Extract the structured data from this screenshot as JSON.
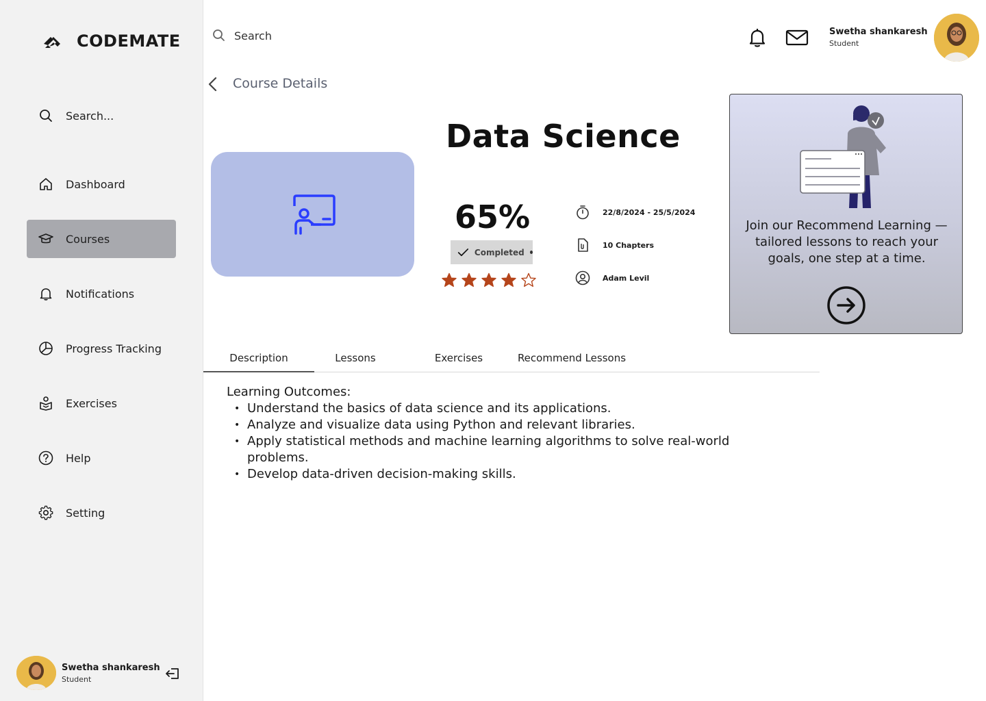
{
  "app": {
    "brand": "CODEMATE"
  },
  "sidebar": {
    "search_label": "Search...",
    "items": [
      {
        "label": "Dashboard",
        "icon": "home-icon"
      },
      {
        "label": "Courses",
        "icon": "graduation-cap-icon",
        "active": true
      },
      {
        "label": "Notifications",
        "icon": "bell-icon"
      },
      {
        "label": "Progress Tracking",
        "icon": "pie-chart-icon"
      },
      {
        "label": "Exercises",
        "icon": "exercise-icon"
      },
      {
        "label": "Help",
        "icon": "help-icon"
      },
      {
        "label": "Setting",
        "icon": "gear-icon"
      }
    ],
    "profile": {
      "name": "Swetha shankaresh",
      "role": "Student"
    }
  },
  "header": {
    "search_label": "Search",
    "profile": {
      "name": "Swetha shankaresh",
      "role": "Student"
    }
  },
  "page": {
    "heading": "Course Details"
  },
  "course": {
    "title": "Data Science",
    "progress_percent": "65%",
    "status": "Completed",
    "rating": 4,
    "rating_max": 5,
    "dates": "22/8/2024 - 25/5/2024",
    "chapters": "10 Chapters",
    "instructor": "Adam Levil"
  },
  "promo": {
    "text": "Join our Recommend Learning — tailored lessons to reach your goals, one step at a time."
  },
  "tabs": [
    {
      "label": "Description",
      "active": true
    },
    {
      "label": "Lessons"
    },
    {
      "label": "Exercises"
    },
    {
      "label": "Recommend Lessons"
    }
  ],
  "description": {
    "heading": "Learning Outcomes:",
    "items": [
      "Understand the basics of data science and its applications.",
      "Analyze and visualize data using Python and relevant libraries.",
      "Apply statistical methods and machine learning algorithms to solve real-world problems.",
      "Develop data-driven decision-making skills."
    ]
  },
  "colors": {
    "sidebar_bg": "#f2f2f2",
    "active_nav": "#a8a9ae",
    "thumb_bg": "#b3bee6",
    "thumb_icon": "#2a3dff",
    "star": "#b5451b"
  }
}
